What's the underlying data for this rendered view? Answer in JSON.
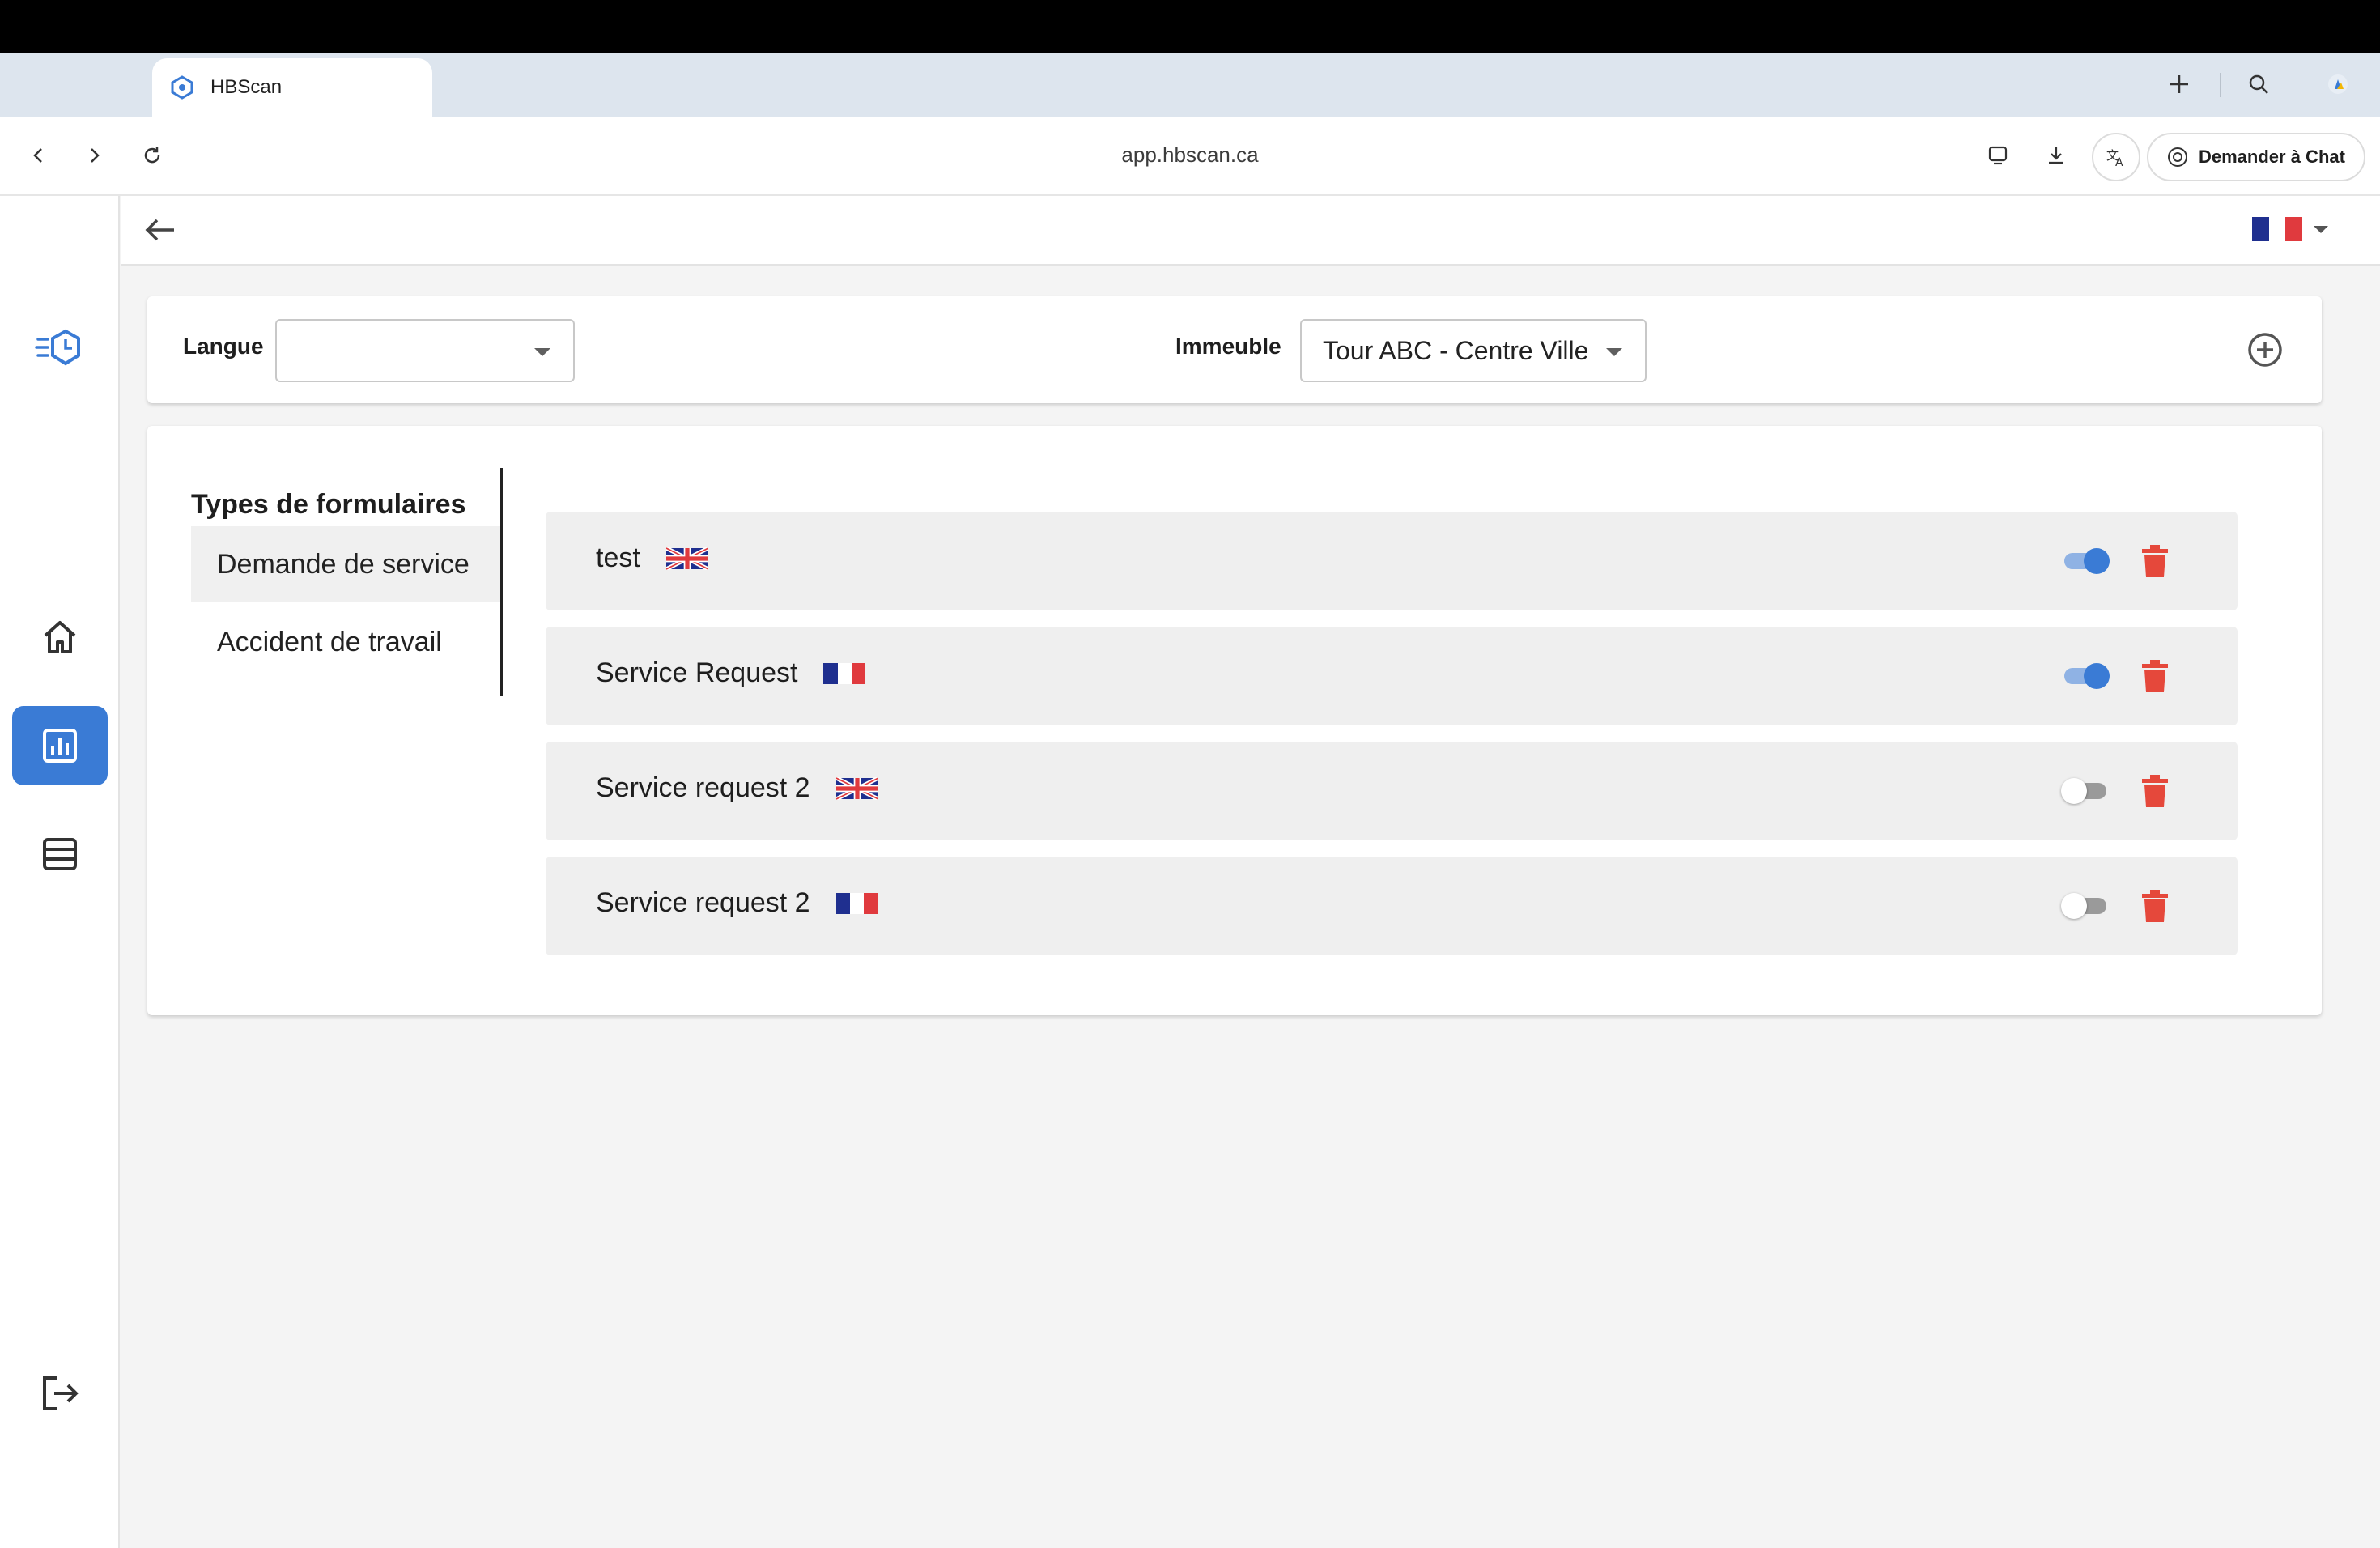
{
  "browser": {
    "tab_title": "HBScan",
    "url": "app.hbscan.ca",
    "ask_chat_label": "Demander à Chat"
  },
  "sidebar": {
    "items": [
      {
        "icon": "logo-icon"
      },
      {
        "icon": "home-icon"
      },
      {
        "icon": "chart-icon",
        "active": true
      },
      {
        "icon": "list-icon"
      },
      {
        "icon": "logout-icon"
      }
    ]
  },
  "topbar": {
    "language_flag": "fr"
  },
  "filters": {
    "language_label": "Langue",
    "language_value": "",
    "building_label": "Immeuble",
    "building_value": "Tour ABC - Centre Ville"
  },
  "form_types": {
    "title": "Types de formulaires",
    "items": [
      "Demande de service",
      "Accident de travail"
    ],
    "selected": "Demande de service"
  },
  "forms": [
    {
      "name": "test",
      "flag": "uk",
      "enabled": true
    },
    {
      "name": "Service Request",
      "flag": "fr",
      "enabled": true
    },
    {
      "name": "Service request 2",
      "flag": "uk",
      "enabled": false
    },
    {
      "name": "Service request 2",
      "flag": "fr",
      "enabled": false
    }
  ],
  "colors": {
    "accent": "#3a7bd5",
    "delete": "#e5483b",
    "flag_blue": "#1f2f8f",
    "flag_red": "#e03a3e"
  }
}
